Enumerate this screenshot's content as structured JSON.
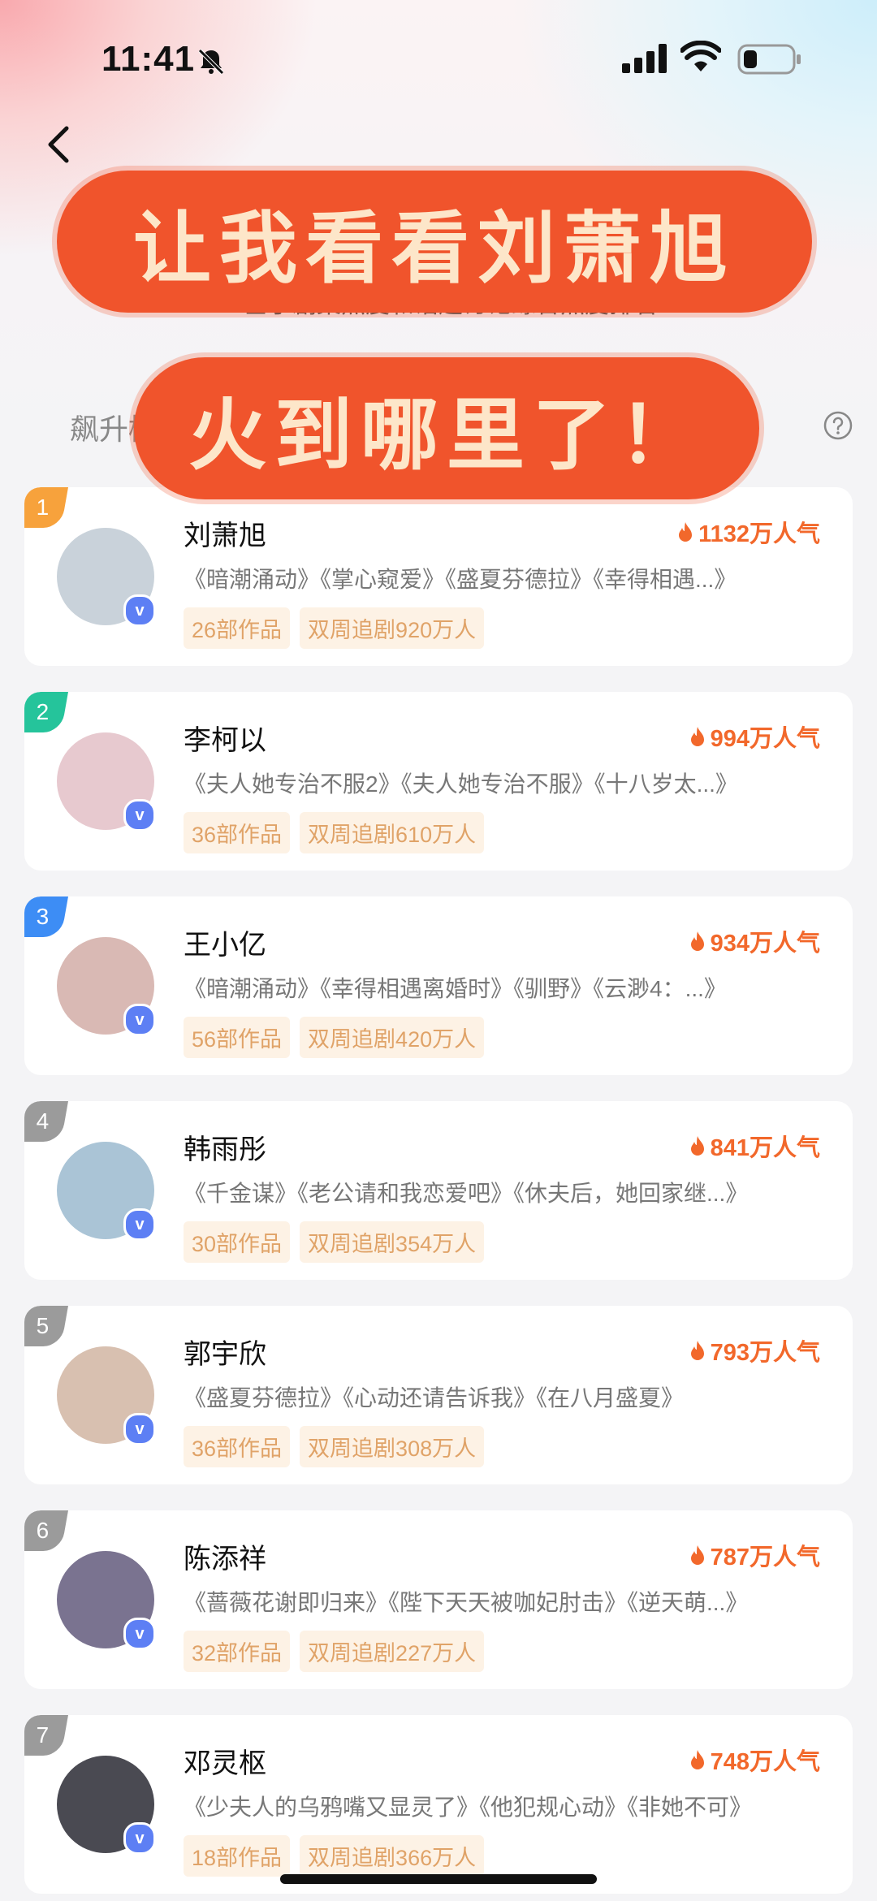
{
  "status_bar": {
    "time": "11:41"
  },
  "header": {
    "subtitle": "基于剧集热度和话题讨论综合热度排名",
    "tab_label": "飙升榜"
  },
  "banner": {
    "line1": "让我看看刘萧旭",
    "line2": "火到哪里了！"
  },
  "ranking": [
    {
      "rank": "1",
      "rank_color": "#f7a23c",
      "name": "刘萧旭",
      "heat": "1132万人气",
      "works": "《暗潮涌动》《掌心窥爱》《盛夏芬德拉》《幸得相遇...》",
      "count": "26部作品",
      "chase": "双周追剧920万人",
      "avatar_color": "#c9d2da"
    },
    {
      "rank": "2",
      "rank_color": "#25c49b",
      "name": "李柯以",
      "heat": "994万人气",
      "works": "《夫人她专治不服2》《夫人她专治不服》《十八岁太...》",
      "count": "36部作品",
      "chase": "双周追剧610万人",
      "avatar_color": "#e7c9cf"
    },
    {
      "rank": "3",
      "rank_color": "#3d8df5",
      "name": "王小亿",
      "heat": "934万人气",
      "works": "《暗潮涌动》《幸得相遇离婚时》《驯野》《云渺4：...》",
      "count": "56部作品",
      "chase": "双周追剧420万人",
      "avatar_color": "#d9b9b4"
    },
    {
      "rank": "4",
      "rank_color": "#9b9b9b",
      "name": "韩雨彤",
      "heat": "841万人气",
      "works": "《千金谋》《老公请和我恋爱吧》《休夫后，她回家继...》",
      "count": "30部作品",
      "chase": "双周追剧354万人",
      "avatar_color": "#aac4d6"
    },
    {
      "rank": "5",
      "rank_color": "#9b9b9b",
      "name": "郭宇欣",
      "heat": "793万人气",
      "works": "《盛夏芬德拉》《心动还请告诉我》《在八月盛夏》",
      "count": "36部作品",
      "chase": "双周追剧308万人",
      "avatar_color": "#d8c0b0"
    },
    {
      "rank": "6",
      "rank_color": "#9b9b9b",
      "name": "陈添祥",
      "heat": "787万人气",
      "works": "《蔷薇花谢即归来》《陛下天天被咖妃肘击》《逆天萌...》",
      "count": "32部作品",
      "chase": "双周追剧227万人",
      "avatar_color": "#7a7390"
    },
    {
      "rank": "7",
      "rank_color": "#9b9b9b",
      "name": "邓灵枢",
      "heat": "748万人气",
      "works": "《少夫人的乌鸦嘴又显灵了》《他犯规心动》《非她不可》",
      "count": "18部作品",
      "chase": "双周追剧366万人",
      "avatar_color": "#4a4a52"
    }
  ]
}
